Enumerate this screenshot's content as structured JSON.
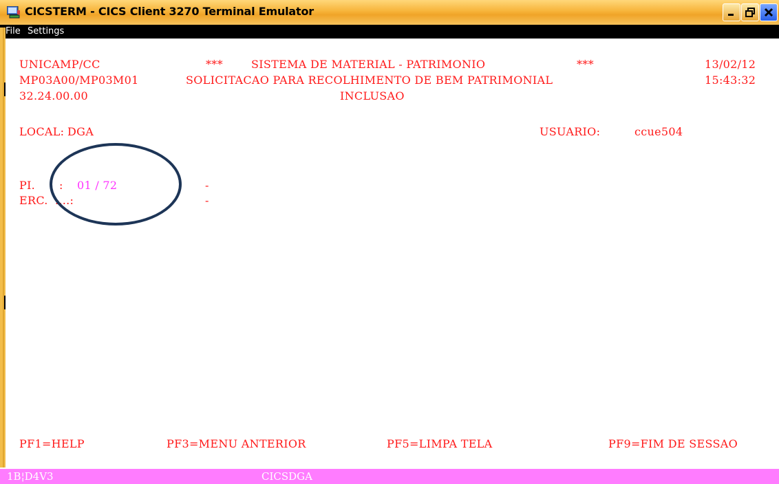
{
  "window": {
    "title": "CICSTERM - CICS Client 3270 Terminal Emulator"
  },
  "menu": {
    "file": "File",
    "settings": "Settings"
  },
  "screen": {
    "org": "UNICAMP/CC",
    "stars_left": "***",
    "system_title": "SISTEMA DE MATERIAL - PATRIMONIO",
    "stars_right": "***",
    "date": "13/02/12",
    "program": "MP03A00/MP03M01",
    "subtitle": "SOLICITACAO PARA RECOLHIMENTO DE BEM PATRIMONIAL",
    "time": "15:43:32",
    "code": "32.24.00.00",
    "mode": "INCLUSAO",
    "local_label": "LOCAL:",
    "local_value": "DGA",
    "user_label": "USUARIO:",
    "user_value": "ccue504",
    "pi_label": "PI.",
    "pi_colon": ":",
    "pi_value": "01 / 72",
    "pi_dash": "-",
    "erc_label": "ERC.",
    "erc_dots": "....:",
    "erc_dash": "-"
  },
  "function_keys": {
    "pf1": "PF1=HELP",
    "pf3": "PF3=MENU ANTERIOR",
    "pf5": "PF5=LIMPA TELA",
    "pf9": "PF9=FIM DE SESSAO"
  },
  "statusbar": {
    "left": "1B¦D4V3",
    "terminal": "CICSDGA"
  },
  "colors": {
    "terminal_text": "#ff1a1a",
    "input_text": "#ff33ff",
    "status_bar": "#ff7cff",
    "annotation": "#1d3557"
  }
}
